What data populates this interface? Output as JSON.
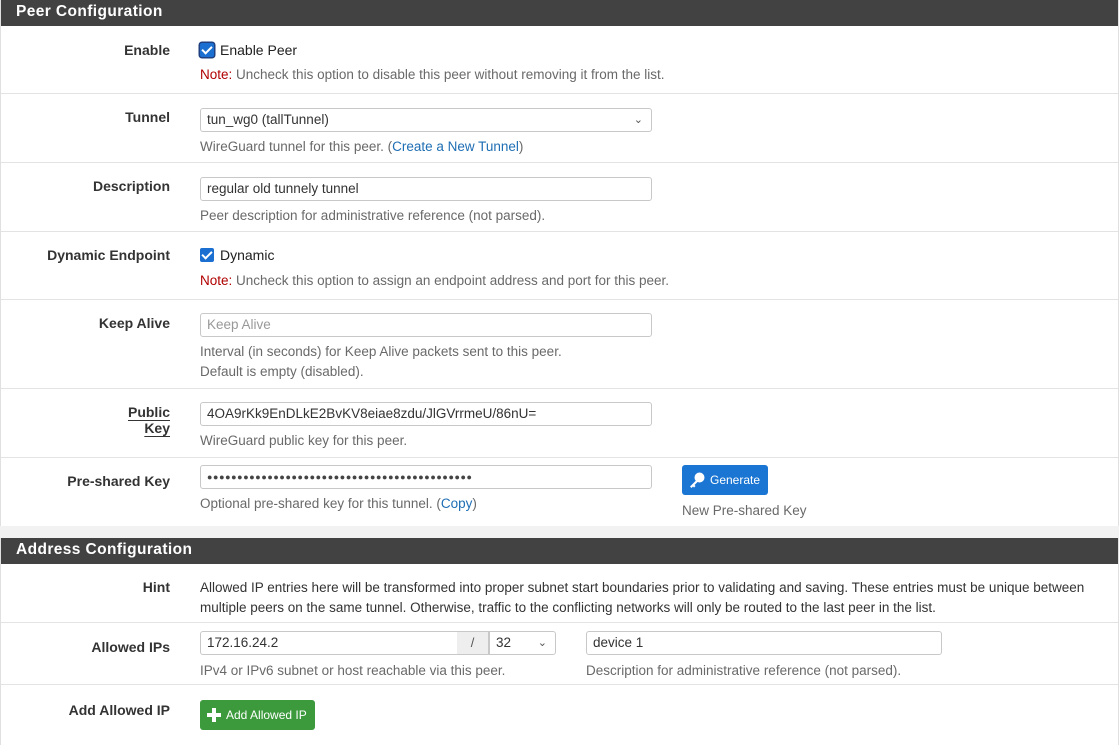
{
  "peer_config": {
    "heading": "Peer Configuration",
    "enable": {
      "label": "Enable",
      "checkbox_label": "Enable Peer",
      "checked": true,
      "note_prefix": "Note:",
      "note_text": " Uncheck this option to disable this peer without removing it from the list."
    },
    "tunnel": {
      "label": "Tunnel",
      "selected": "tun_wg0 (tallTunnel)",
      "help_before": "WireGuard tunnel for this peer. (",
      "help_link": "Create a New Tunnel",
      "help_after": ")"
    },
    "description": {
      "label": "Description",
      "value": "regular old tunnely tunnel",
      "help": "Peer description for administrative reference (not parsed)."
    },
    "dynamic_endpoint": {
      "label": "Dynamic Endpoint",
      "checkbox_label": "Dynamic",
      "checked": true,
      "note_prefix": "Note:",
      "note_text": " Uncheck this option to assign an endpoint address and port for this peer."
    },
    "keep_alive": {
      "label": "Keep Alive",
      "value": "",
      "placeholder": "Keep Alive",
      "help_line1": "Interval (in seconds) for Keep Alive packets sent to this peer.",
      "help_line2": "Default is empty (disabled)."
    },
    "public_key": {
      "label": "Public Key",
      "value": "4OA9rKk9EnDLkE2BvKV8eiae8zdu/JlGVrrmeU/86nU=",
      "help": "WireGuard public key for this peer."
    },
    "preshared_key": {
      "label": "Pre-shared Key",
      "value_masked": "●●●●●●●●●●●●●●●●●●●●●●●●●●●●●●●●●●●●●●●●●●●●",
      "help_before": "Optional pre-shared key for this tunnel. (",
      "help_link": "Copy",
      "help_after": ")",
      "generate_button": "Generate",
      "generate_help": "New Pre-shared Key",
      "button_color": "#1b76d3"
    }
  },
  "address_config": {
    "heading": "Address Configuration",
    "hint": {
      "label": "Hint",
      "text": "Allowed IP entries here will be transformed into proper subnet start boundaries prior to validating and saving. These entries must be unique between multiple peers on the same tunnel. Otherwise, traffic to the conflicting networks will only be routed to the last peer in the list."
    },
    "allowed_ips": {
      "label": "Allowed IPs",
      "address": "172.16.24.2",
      "separator": "/",
      "mask": "32",
      "address_help": "IPv4 or IPv6 subnet or host reachable via this peer.",
      "description": "device 1",
      "description_help": "Description for administrative reference (not parsed)."
    },
    "add_allowed_ip": {
      "label": "Add Allowed IP",
      "button": "Add Allowed IP",
      "button_color": "#3c9a3c"
    }
  }
}
